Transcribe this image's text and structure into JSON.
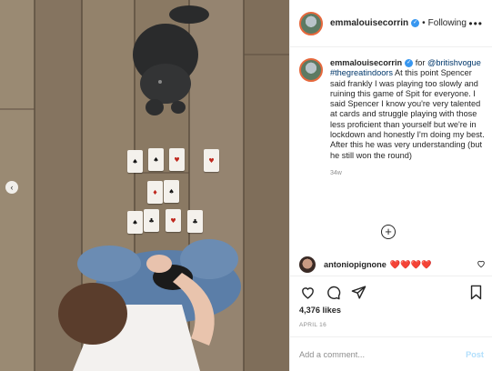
{
  "post": {
    "username": "emmalouisecorrin",
    "follow_status": "Following",
    "more_label": "•••",
    "verified_glyph": "✓"
  },
  "caption": {
    "username": "emmalouisecorrin",
    "for_word": "for",
    "mention": "@britishvogue",
    "hashtag": "#thegreatindoors",
    "text": "At this point Spencer said frankly I was playing too slowly and ruining this game of Spit for everyone. I said Spencer I know you're very talented at cards and struggle playing with those less proficient than yourself but we're in lockdown and honestly I'm doing my best. After this he was very understanding (but he still won the round)",
    "time": "34w"
  },
  "load_more_label": "+",
  "comment": {
    "username": "antoniopignone",
    "text": "❤️❤️❤️❤️"
  },
  "likes": "4,376 likes",
  "date": "APRIL 16",
  "add_comment": {
    "placeholder": "Add a comment...",
    "post_label": "Post"
  },
  "carousel": {
    "prev_arrow": "‹"
  },
  "icons": {
    "like": "heart-icon",
    "comment": "comment-bubble-icon",
    "share": "paper-plane-icon",
    "save": "bookmark-icon",
    "more": "more-dots-icon"
  },
  "colors": {
    "link": "#00376b",
    "verified": "#3897f0",
    "post_button": "#b2dffc",
    "muted_text": "#8e8e8e"
  },
  "cards": [
    {
      "glyph": "♠",
      "suit": "black"
    },
    {
      "glyph": "♠",
      "suit": "black"
    },
    {
      "glyph": "♥",
      "suit": "red"
    },
    {
      "glyph": "♥",
      "suit": "red"
    },
    {
      "glyph": "♦",
      "suit": "red"
    },
    {
      "glyph": "♠",
      "suit": "black"
    },
    {
      "glyph": "♠",
      "suit": "black"
    },
    {
      "glyph": "♣",
      "suit": "black"
    },
    {
      "glyph": "♥",
      "suit": "red"
    },
    {
      "glyph": "♣",
      "suit": "black"
    }
  ]
}
